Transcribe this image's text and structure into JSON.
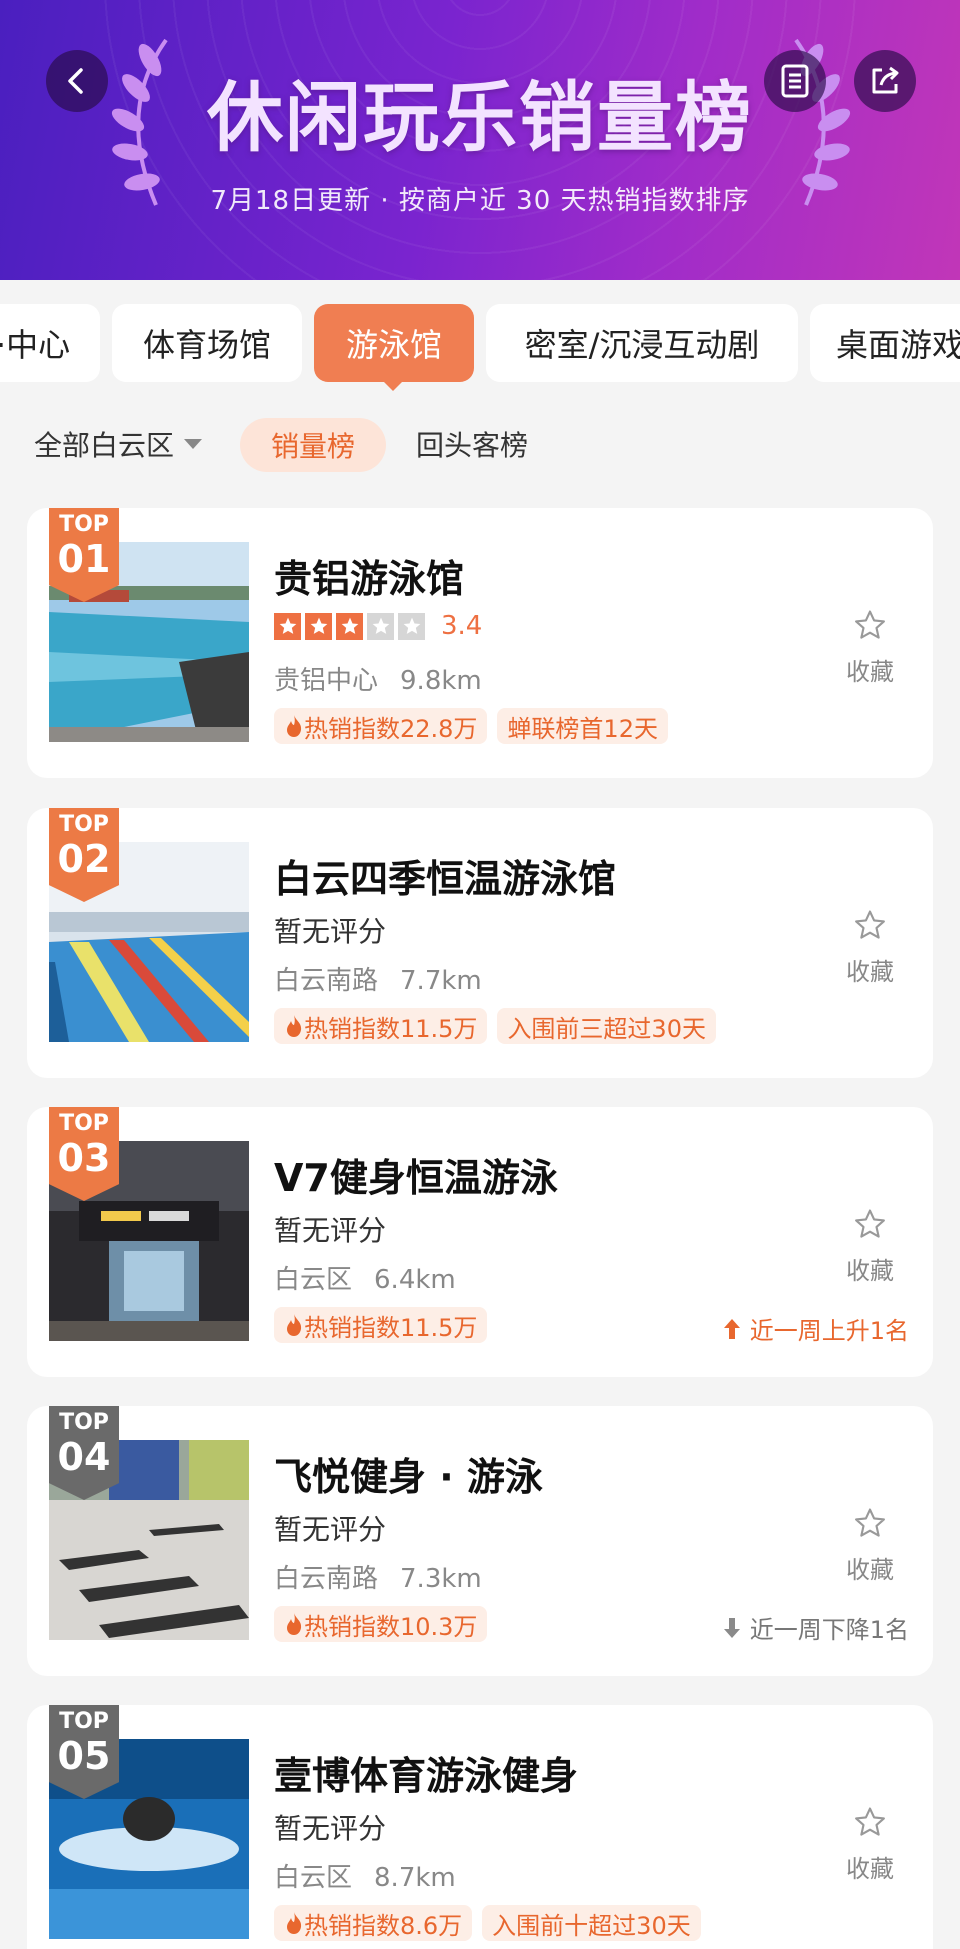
{
  "header": {
    "title": "休闲玩乐销量榜",
    "subtitle": "7月18日更新 · 按商户近 30 天热销指数排序",
    "colors": {
      "gradient_start": "#4a1fbf",
      "gradient_end": "#c136b8"
    }
  },
  "tabs": [
    {
      "label": "·中心"
    },
    {
      "label": "体育场馆"
    },
    {
      "label": "游泳馆",
      "active": true
    },
    {
      "label": "密室/沉浸互动剧"
    },
    {
      "label": "桌面游戏"
    }
  ],
  "filters": {
    "district": "全部白云区",
    "sales_rank": "销量榜",
    "repeat_rank": "回头客榜"
  },
  "accent_color": "#ee7042",
  "items": [
    {
      "rank_top": "TOP",
      "rank": "01",
      "badge_color": "orange",
      "name": "贵铝游泳馆",
      "rating": 3.4,
      "rating_text": "3.4",
      "stars_filled": 3,
      "area": "贵铝中心",
      "distance": "9.8km",
      "tags": [
        "热销指数22.8万",
        "蝉联榜首12天"
      ],
      "fav_label": "收藏"
    },
    {
      "rank_top": "TOP",
      "rank": "02",
      "badge_color": "orange",
      "name": "白云四季恒温游泳馆",
      "rating_text": "暂无评分",
      "area": "白云南路",
      "distance": "7.7km",
      "tags": [
        "热销指数11.5万",
        "入围前三超过30天"
      ],
      "fav_label": "收藏"
    },
    {
      "rank_top": "TOP",
      "rank": "03",
      "badge_color": "orange",
      "name": "V7健身恒温游泳",
      "rating_text": "暂无评分",
      "area": "白云区",
      "distance": "6.4km",
      "tags": [
        "热销指数11.5万"
      ],
      "trend": {
        "direction": "up",
        "text": "近一周上升1名"
      },
      "fav_label": "收藏"
    },
    {
      "rank_top": "TOP",
      "rank": "04",
      "badge_color": "gray",
      "name": "飞悦健身 · 游泳",
      "rating_text": "暂无评分",
      "area": "白云南路",
      "distance": "7.3km",
      "tags": [
        "热销指数10.3万"
      ],
      "trend": {
        "direction": "down",
        "text": "近一周下降1名"
      },
      "fav_label": "收藏"
    },
    {
      "rank_top": "TOP",
      "rank": "05",
      "badge_color": "gray",
      "name": "壹博体育游泳健身",
      "rating_text": "暂无评分",
      "area": "白云区",
      "distance": "8.7km",
      "tags": [
        "热销指数8.6万",
        "入围前十超过30天"
      ],
      "fav_label": "收藏"
    }
  ]
}
